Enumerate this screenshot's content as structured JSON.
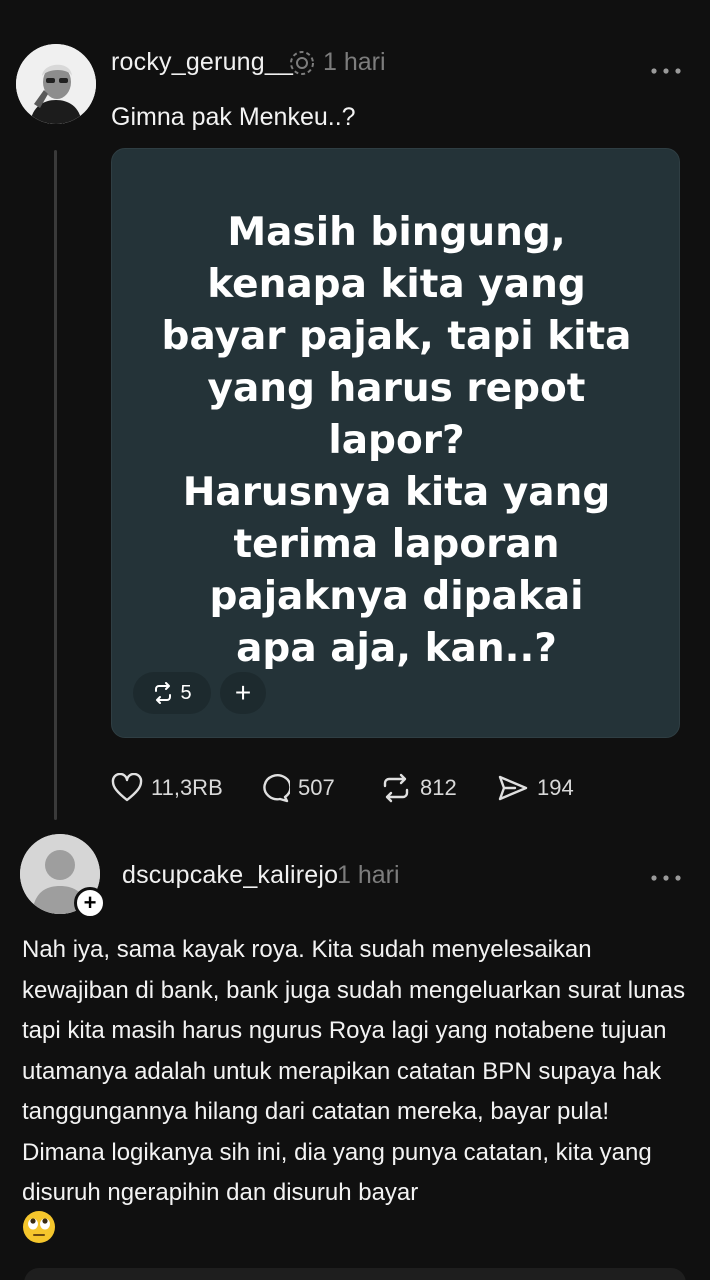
{
  "post1": {
    "username": "rocky_gerung__",
    "time": "1 hari",
    "caption": "Gimna pak Menkeu..?",
    "image_text_lines": [
      "Masih bingung,",
      "kenapa kita yang",
      "bayar pajak, tapi kita",
      "yang harus repot",
      "lapor?",
      "Harusnya kita yang",
      "terima laporan",
      "pajaknya dipakai",
      "apa aja, kan..?"
    ],
    "repost_pill_count": "5",
    "stats": {
      "likes": "11,3RB",
      "comments": "507",
      "reposts": "812",
      "shares": "194"
    }
  },
  "post2": {
    "username": "dscupcake_kalirejo",
    "time": "1 hari",
    "body": "Nah iya, sama kayak roya. Kita sudah menyelesaikan kewajiban di bank, bank juga sudah mengeluarkan surat lunas tapi kita masih harus ngurus Roya lagi yang notabene tujuan utamanya adalah untuk merapikan catatan BPN supaya hak tanggungannya hilang dari catatan mereka, bayar pula! Dimana logikanya sih ini, dia yang punya catatan, kita yang disuruh ngerapihin dan disuruh bayar"
  },
  "icons": {
    "more": "more-horizontal-icon",
    "reposted": "reposted-badge-icon",
    "like": "heart-icon",
    "comment": "comment-icon",
    "repost": "repost-icon",
    "share": "send-icon",
    "follow": "plus-icon",
    "emoji": "rolling-eyes-emoji"
  },
  "colors": {
    "background": "#101010",
    "card": "#243338",
    "muted": "#7d7d7d"
  }
}
